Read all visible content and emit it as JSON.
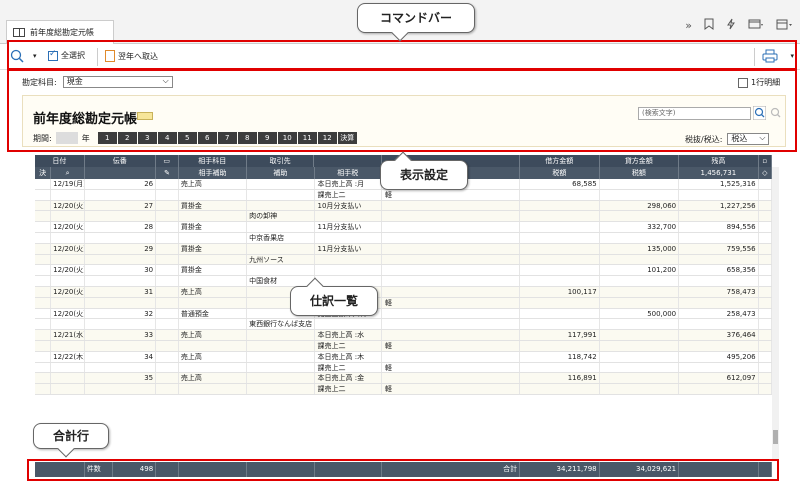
{
  "tab": {
    "title": "前年度総勘定元帳"
  },
  "top_icons": [
    "double-chevron-icon",
    "bookmark-icon",
    "lightning-icon",
    "window-icon",
    "calendar-icon"
  ],
  "command_bar": {
    "select_all_label": "全選択",
    "import_label": "翌年へ取込"
  },
  "filters": {
    "account_label": "勘定科目:",
    "account_value": "現金",
    "one_line_label": "1行明細"
  },
  "ledger": {
    "title": "前年度総勘定元帳",
    "search_placeholder": "(検索文字)",
    "period_label": "期間:",
    "year_suffix": "年",
    "months": [
      "1",
      "2",
      "3",
      "4",
      "5",
      "6",
      "7",
      "8",
      "9",
      "10",
      "11",
      "12"
    ],
    "settlement_label": "決算",
    "tax_label": "税抜/税込:",
    "tax_value": "税込"
  },
  "table": {
    "header1": {
      "date": "日付",
      "no": "伝番",
      "account": "相手科目",
      "partner": "取引先",
      "debit": "借方金額",
      "credit": "貸方金額",
      "balance": "残高"
    },
    "header2": {
      "settle": "決",
      "sub": "相手補助",
      "aux": "補助",
      "tax_a": "相手税",
      "tax_b": "税区分",
      "debit_tax": "税額",
      "credit_tax": "税額",
      "balance_val": "1,456,731"
    },
    "rows": [
      {
        "date": "12/19(月)",
        "no": "26",
        "acct": "売上高",
        "sub": "",
        "desc": "本日売上高 :月",
        "tax": "",
        "dr": "68,585",
        "cr": "",
        "bal": "1,525,316"
      },
      {
        "date": "",
        "no": "",
        "acct": "",
        "sub": "",
        "desc": "課売上二",
        "tax": "軽",
        "dr": "",
        "cr": "",
        "bal": ""
      },
      {
        "date": "12/20(火)",
        "no": "27",
        "acct": "買掛金",
        "sub": "",
        "desc": "10月分支払い",
        "tax": "",
        "dr": "",
        "cr": "298,060",
        "bal": "1,227,256"
      },
      {
        "date": "",
        "no": "",
        "acct": "",
        "sub": "肉の卸神",
        "desc": "",
        "tax": "",
        "dr": "",
        "cr": "",
        "bal": ""
      },
      {
        "date": "12/20(火)",
        "no": "28",
        "acct": "買掛金",
        "sub": "",
        "desc": "11月分支払い",
        "tax": "",
        "dr": "",
        "cr": "332,700",
        "bal": "894,556"
      },
      {
        "date": "",
        "no": "",
        "acct": "",
        "sub": "中京香果店",
        "desc": "",
        "tax": "",
        "dr": "",
        "cr": "",
        "bal": ""
      },
      {
        "date": "12/20(火)",
        "no": "29",
        "acct": "買掛金",
        "sub": "",
        "desc": "11月分支払い",
        "tax": "",
        "dr": "",
        "cr": "135,000",
        "bal": "759,556"
      },
      {
        "date": "",
        "no": "",
        "acct": "",
        "sub": "九州ソース",
        "desc": "",
        "tax": "",
        "dr": "",
        "cr": "",
        "bal": ""
      },
      {
        "date": "12/20(火)",
        "no": "30",
        "acct": "買掛金",
        "sub": "",
        "desc": "",
        "tax": "",
        "dr": "",
        "cr": "101,200",
        "bal": "658,356"
      },
      {
        "date": "",
        "no": "",
        "acct": "",
        "sub": "中国食材",
        "desc": "",
        "tax": "",
        "dr": "",
        "cr": "",
        "bal": ""
      },
      {
        "date": "12/20(火)",
        "no": "31",
        "acct": "売上高",
        "sub": "",
        "desc": "本日売上高 :火",
        "tax": "",
        "dr": "100,117",
        "cr": "",
        "bal": "758,473"
      },
      {
        "date": "",
        "no": "",
        "acct": "",
        "sub": "",
        "desc": "課売上二",
        "tax": "軽",
        "dr": "",
        "cr": "",
        "bal": ""
      },
      {
        "date": "12/20(火)",
        "no": "32",
        "acct": "普通預金",
        "sub": "",
        "desc": "売上金預け入れ",
        "tax": "",
        "dr": "",
        "cr": "500,000",
        "bal": "258,473"
      },
      {
        "date": "",
        "no": "",
        "acct": "",
        "sub": "東西銀行なんば支店",
        "desc": "",
        "tax": "",
        "dr": "",
        "cr": "",
        "bal": ""
      },
      {
        "date": "12/21(水)",
        "no": "33",
        "acct": "売上高",
        "sub": "",
        "desc": "本日売上高 :水",
        "tax": "",
        "dr": "117,991",
        "cr": "",
        "bal": "376,464"
      },
      {
        "date": "",
        "no": "",
        "acct": "",
        "sub": "",
        "desc": "課売上二",
        "tax": "軽",
        "dr": "",
        "cr": "",
        "bal": ""
      },
      {
        "date": "12/22(木)",
        "no": "34",
        "acct": "売上高",
        "sub": "",
        "desc": "本日売上高 :木",
        "tax": "",
        "dr": "118,742",
        "cr": "",
        "bal": "495,206"
      },
      {
        "date": "",
        "no": "",
        "acct": "",
        "sub": "",
        "desc": "課売上二",
        "tax": "軽",
        "dr": "",
        "cr": "",
        "bal": ""
      },
      {
        "date": "",
        "no": "35",
        "acct": "売上高",
        "sub": "",
        "desc": "本日売上高 :金",
        "tax": "",
        "dr": "116,891",
        "cr": "",
        "bal": "612,097"
      },
      {
        "date": "",
        "no": "",
        "acct": "",
        "sub": "",
        "desc": "課売上二",
        "tax": "軽",
        "dr": "",
        "cr": "",
        "bal": ""
      }
    ],
    "footer": {
      "count_label": "件数",
      "count": "498",
      "total_label": "合計",
      "debit_total": "34,211,798",
      "credit_total": "34,029,621"
    }
  },
  "callouts": {
    "command_bar": "コマンドバー",
    "display_settings": "表示設定",
    "journal_list": "仕訳一覧",
    "totals_row": "合計行"
  },
  "colors": {
    "highlight": "#e00000",
    "header": "#3d4b5c",
    "month_button": "#3d3d3d",
    "settings_bg": "#fffdf5"
  }
}
